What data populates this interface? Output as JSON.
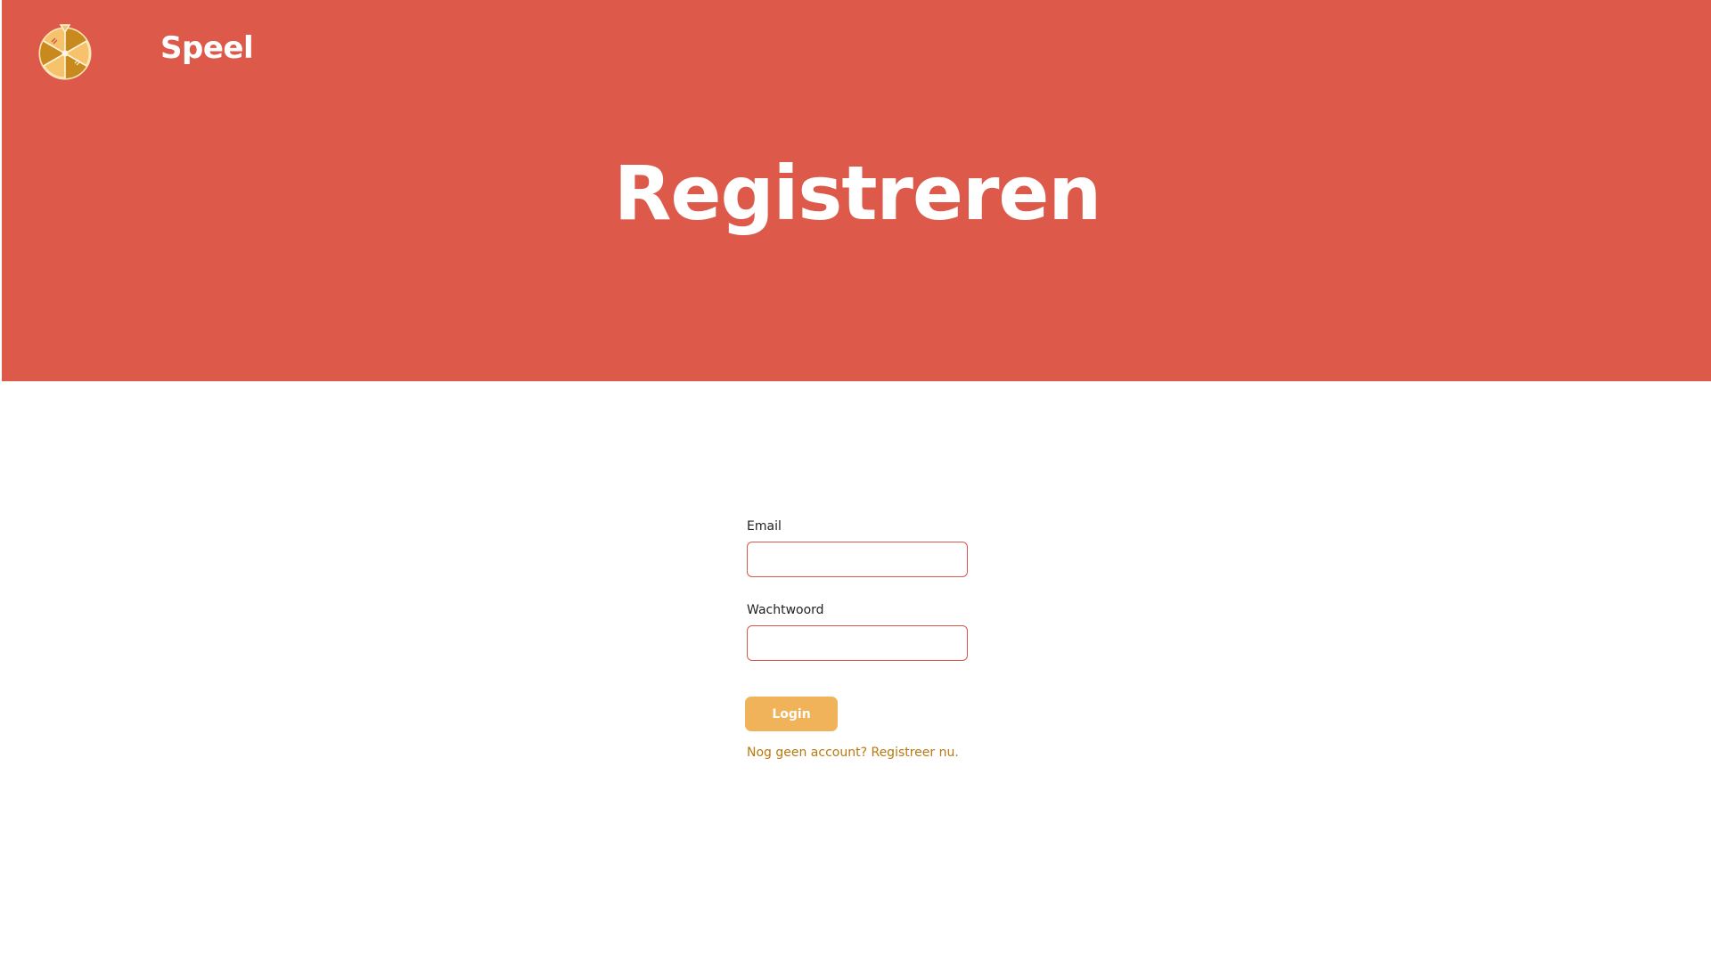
{
  "header": {
    "logo_icon": "prize-wheel-icon",
    "brand": "Speel",
    "background_color": "#dd5a4a"
  },
  "hero": {
    "title": "Registreren"
  },
  "form": {
    "email_label": "Email",
    "email_value": "",
    "password_label": "Wachtwoord",
    "password_value": "",
    "submit_label": "Login",
    "register_link": "Nog geen account? Registreer nu.",
    "input_border_color": "#d9574b",
    "button_color": "#f0b35a",
    "link_color": "#b87a0e"
  }
}
